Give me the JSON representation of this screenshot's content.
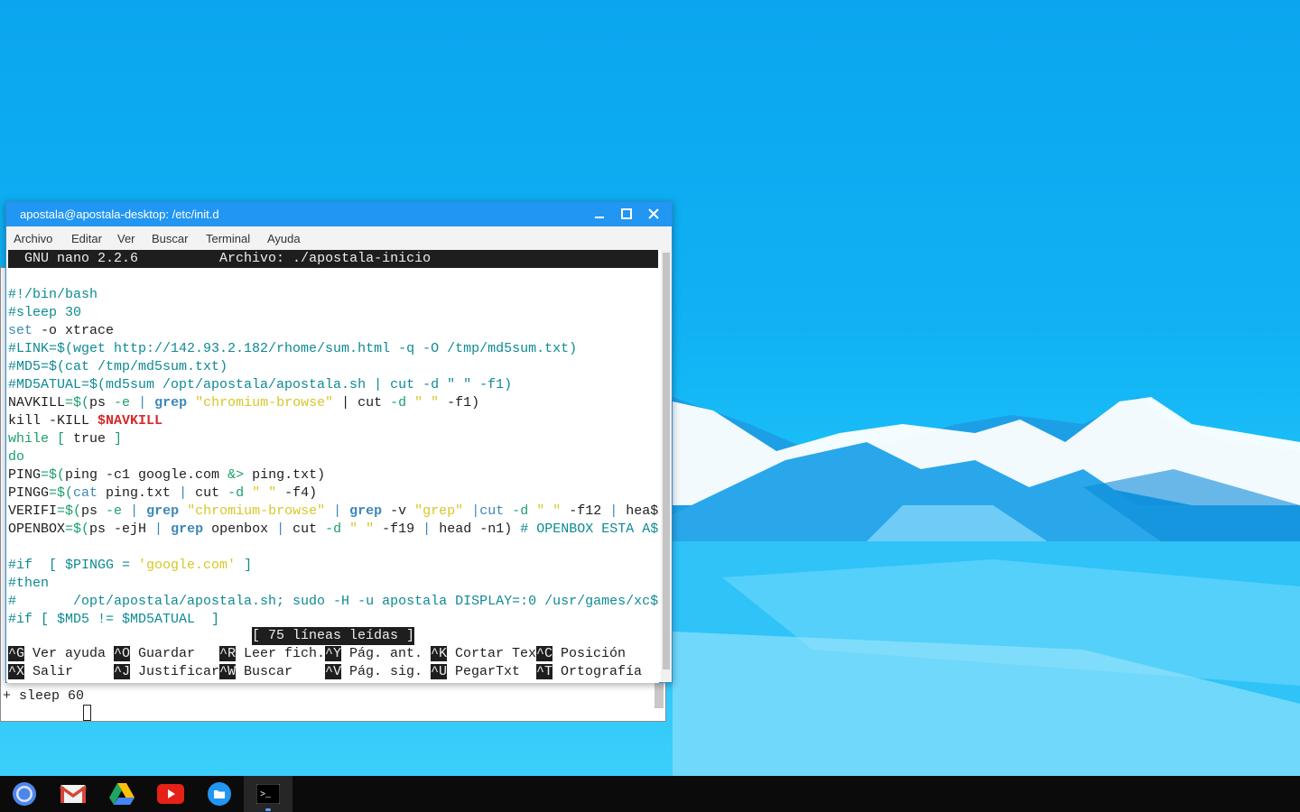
{
  "window": {
    "title": "apostala@apostala-desktop: /etc/init.d",
    "menu": [
      "Archivo",
      "Editar",
      "Ver",
      "Buscar",
      "Terminal",
      "Ayuda"
    ]
  },
  "nano": {
    "header_left": "  GNU nano 2.2.6",
    "header_file": "Archivo: ./apostala-inicio",
    "lines": {
      "l1": "#!/bin/bash",
      "l2": "#sleep 30",
      "l3_kw": "set",
      "l3_rest": " -o xtrace",
      "l4": "#LINK=$(wget http://142.93.2.182/rhome/sum.html -q -O /tmp/md5sum.txt)",
      "l5": "#MD5=$(cat /tmp/md5sum.txt)",
      "l6": "#MD5ATUAL=$(md5sum /opt/apostala/apostala.sh | cut -d \" \" -f1)",
      "l7_a": "NAVKILL",
      "l7_b": "=$(",
      "l7_c": "ps ",
      "l7_d": "-e",
      "l7_e": " | ",
      "l7_f": "grep",
      "l7_g": " \"chromium-browse\"",
      "l7_h": " | cut ",
      "l7_i": "-d",
      "l7_j": " \" \"",
      "l7_k": " -f1)",
      "l8_a": "kill -KILL ",
      "l8_b": "$NAVKILL",
      "l9_a": "while",
      "l9_b": " [ ",
      "l9_c": "true",
      "l9_d": " ]",
      "l10": "do",
      "l11_a": "PING",
      "l11_b": "=$(",
      "l11_c": "ping -c1 google.com ",
      "l11_d": "&>",
      "l11_e": " ping.txt)",
      "l12_a": "PINGG",
      "l12_b": "=$(",
      "l12_c": "cat",
      "l12_d": " ping.txt ",
      "l12_e": "|",
      "l12_f": " cut ",
      "l12_g": "-d",
      "l12_h": " \" \"",
      "l12_i": " -f4)",
      "l13_a": "VERIFI",
      "l13_b": "=$(",
      "l13_c": "ps ",
      "l13_d": "-e",
      "l13_e": " | ",
      "l13_f": "grep",
      "l13_g": " \"chromium-browse\"",
      "l13_h": " | ",
      "l13_i": "grep",
      "l13_j": " -v ",
      "l13_k": "\"grep\"",
      "l13_l": " |cut ",
      "l13_m": "-d",
      "l13_n": " \" \"",
      "l13_o": " -f12 ",
      "l13_p": "|",
      "l13_q": " hea$",
      "l14_a": "OPENBOX",
      "l14_b": "=$(",
      "l14_c": "ps -ejH ",
      "l14_d": "|",
      "l14_e": " grep",
      "l14_f": " openbox ",
      "l14_g": "|",
      "l14_h": " cut ",
      "l14_i": "-d",
      "l14_j": " \" \"",
      "l14_k": " -f19 ",
      "l14_l": "|",
      "l14_m": " head -n1) ",
      "l14_n": "# OPENBOX ESTA A$",
      "l16_a": "#if  [ $PINGG = ",
      "l16_b": "'google.com'",
      "l16_c": " ]",
      "l17": "#then",
      "l18": "#       /opt/apostala/apostala.sh; sudo -H -u apostala DISPLAY=:0 /usr/games/xc$",
      "l19": "#if [ $MD5 != $MD5ATUAL  ]"
    },
    "status": "[ 75 líneas leídas ]",
    "shortcuts_row1": [
      {
        "key": "^G",
        "label": "Ver ayuda"
      },
      {
        "key": "^O",
        "label": "Guardar"
      },
      {
        "key": "^R",
        "label": "Leer fich."
      },
      {
        "key": "^Y",
        "label": "Pág. ant."
      },
      {
        "key": "^K",
        "label": "Cortar Tex"
      },
      {
        "key": "^C",
        "label": "Posición"
      }
    ],
    "shortcuts_row2": [
      {
        "key": "^X",
        "label": "Salir"
      },
      {
        "key": "^J",
        "label": "Justificar"
      },
      {
        "key": "^W",
        "label": "Buscar"
      },
      {
        "key": "^V",
        "label": "Pág. sig."
      },
      {
        "key": "^U",
        "label": "PegarTxt"
      },
      {
        "key": "^T",
        "label": "Ortografía"
      }
    ]
  },
  "back_terminal": {
    "line": "+ sleep 60"
  },
  "taskbar": {
    "apps": [
      "chrome-icon",
      "gmail-icon",
      "drive-icon",
      "youtube-icon",
      "files-icon",
      "terminal-icon"
    ],
    "terminal_label": ">_"
  },
  "colors": {
    "titlebar": "#2196f3",
    "taskbar": "#0b0b0b",
    "comment": "#0e8a94",
    "keyword": "#3a88b8",
    "string": "#d7c726",
    "variable": "#d62a2a"
  }
}
